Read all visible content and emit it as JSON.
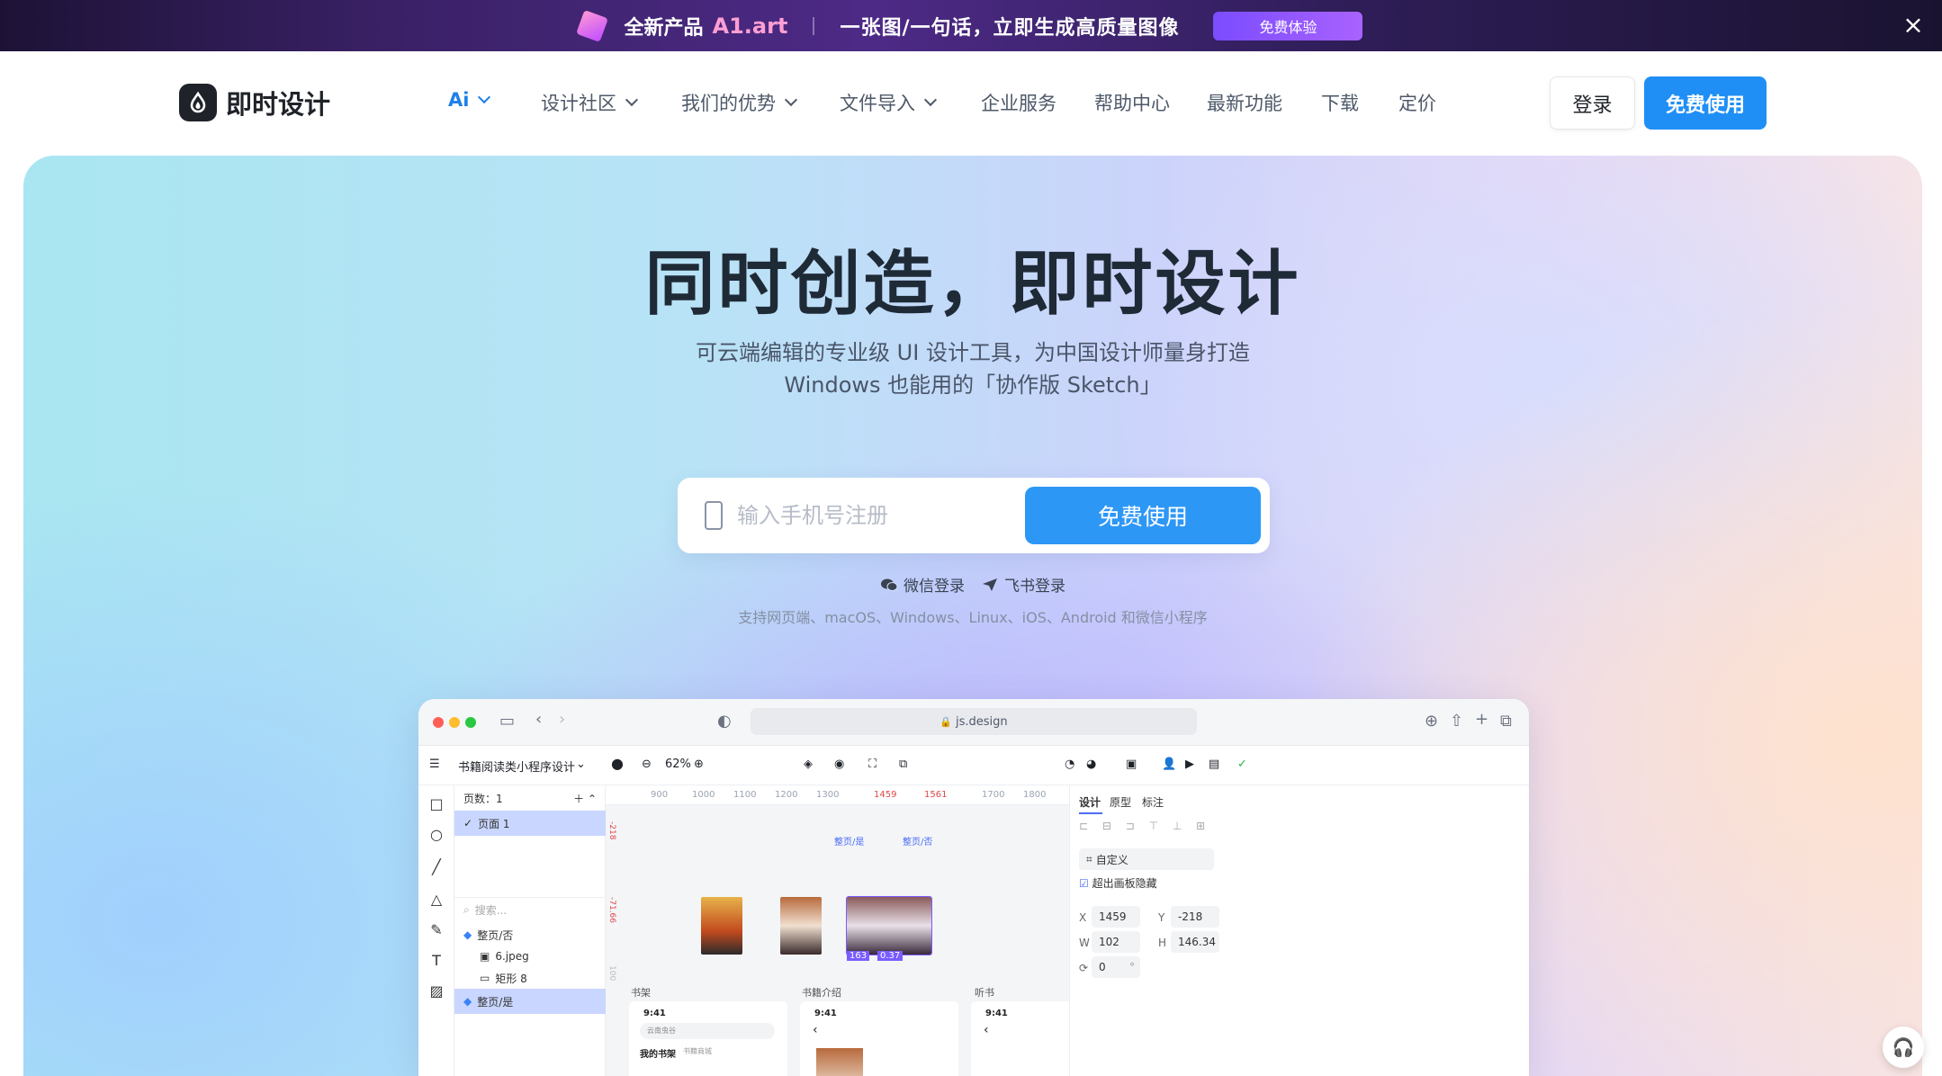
{
  "promo": {
    "product_label": "全新产品",
    "product_name": "A1.art",
    "slogan": "一张图/一句话，立即生成高质量图像",
    "cta": "免费体验",
    "close": "×"
  },
  "header": {
    "logo_text": "即时设计",
    "menu": [
      {
        "label": "Ai",
        "active": true,
        "dropdown": true
      },
      {
        "label": "设计社区",
        "dropdown": true
      },
      {
        "label": "我们的优势",
        "dropdown": true
      },
      {
        "label": "文件导入",
        "dropdown": true
      },
      {
        "label": "企业服务"
      },
      {
        "label": "帮助中心"
      },
      {
        "label": "最新功能"
      },
      {
        "label": "下载"
      },
      {
        "label": "定价"
      }
    ],
    "login_label": "登录",
    "free_label": "免费使用"
  },
  "hero": {
    "title": "同时创造，即时设计",
    "subtitle_line1": "可云端编辑的专业级 UI 设计工具，为中国设计师量身打造",
    "subtitle_line2": "Windows 也能用的「协作版 Sketch」",
    "phone_placeholder": "输入手机号注册",
    "cta": "免费使用",
    "wechat_login": "微信登录",
    "feishu_login": "飞书登录",
    "platforms": "支持网页端、macOS、Windows、Linux、iOS、Android 和微信小程序"
  },
  "app": {
    "url": "js.design",
    "file_name": "书籍阅读类小程序设计",
    "zoom": "62%",
    "pages_label": "页数：1",
    "page_item": "页面 1",
    "search_placeholder": "搜索...",
    "layers": [
      "整页/否",
      "6.jpeg",
      "矩形 8",
      "整页/是"
    ],
    "ruler": [
      "900",
      "1000",
      "1100",
      "1200",
      "1300",
      "1459",
      "1561",
      "1700",
      "1800"
    ],
    "frame_labels": [
      "整页/是",
      "整页/否"
    ],
    "section_labels": [
      "书架",
      "书籍介绍",
      "听书"
    ],
    "time": "9:41",
    "my_shelf": "我的书架",
    "shelf_tab2": "书籍商城",
    "search_hint": "云南虫谷",
    "badges": [
      "163",
      "0.37"
    ],
    "vertical_marks": [
      "-218",
      "-71.66",
      "100"
    ],
    "panel_tabs": [
      "设计",
      "原型",
      "标注"
    ],
    "preset": "自定义",
    "clip_label": "超出画板隐藏",
    "x_label": "X",
    "x_value": "1459",
    "y_label": "Y",
    "y_value": "-218",
    "w_label": "W",
    "w_value": "102",
    "h_label": "H",
    "h_value": "146.34",
    "rotation_value": "0",
    "rotation_unit": "°"
  },
  "colors": {
    "accent": "#1f8ff5",
    "nav_active": "#1f7fe8",
    "title": "#1f2a37"
  }
}
